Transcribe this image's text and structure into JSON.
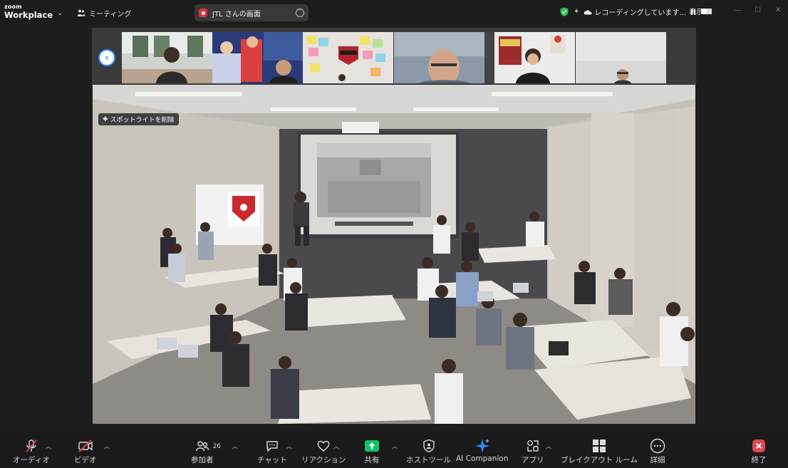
{
  "titlebar": {
    "logo_top": "zoom",
    "logo_bottom": "Workplace",
    "meeting_label": "ミーティング",
    "share_tab_label": "JTL さんの画面",
    "recording_status": "レコーディングしています...",
    "view_label": "表示"
  },
  "spotlight": {
    "remove_label": "スポットライトを削除"
  },
  "toolbar": {
    "audio": "オーディオ",
    "video": "ビデオ",
    "participants": "参加者",
    "participant_count": "26",
    "chat": "チャット",
    "reaction": "リアクション",
    "share": "共有",
    "host_tools": "ホストツール",
    "ai_companion": "AI Companion",
    "apps": "アプリ",
    "breakout": "ブレイクアウト ルーム",
    "more": "詳細",
    "end": "終了"
  },
  "colors": {
    "accent_blue": "#2d8cff",
    "share_green": "#12c36a",
    "end_red": "#e2454b",
    "muted_red": "#e2454b"
  }
}
